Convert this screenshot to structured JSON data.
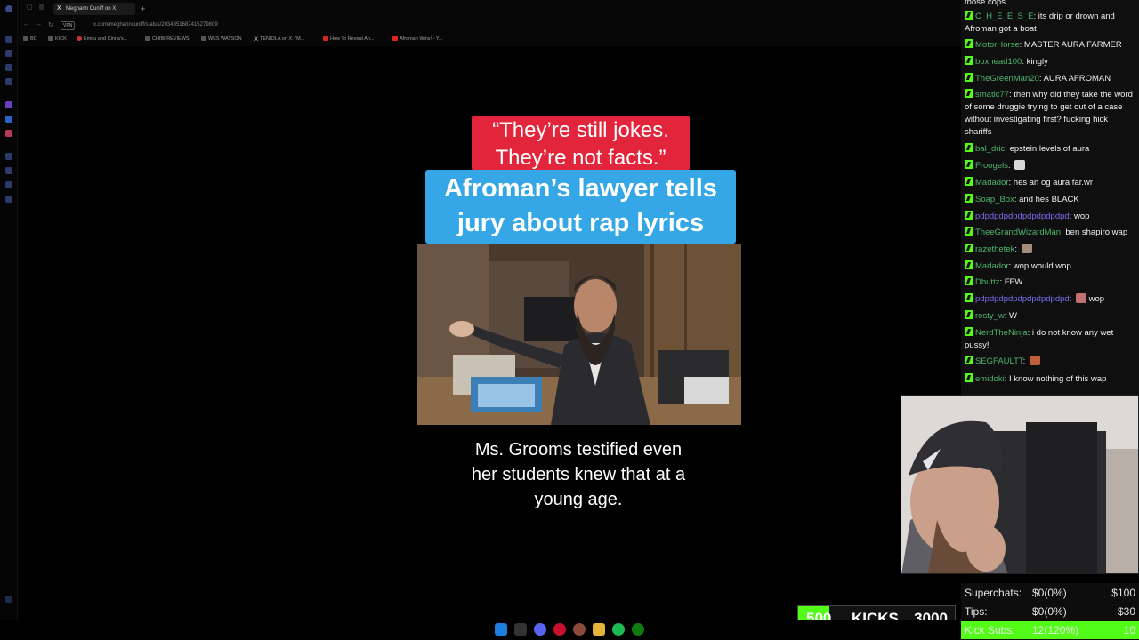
{
  "browser": {
    "tab_title": "Meghann Cuniff on X: ",
    "new_tab": "+",
    "vpn_label": "VPN",
    "url": "x.com/meghanncuniff/status/2034351687415279809",
    "bookmarks": [
      "BC",
      "KICK",
      "Emiru and Cinna's...",
      "CHIBI REVIEWS",
      "WES WATSON",
      "TENIOLA on X: \"M...",
      "How To Reveal An...",
      "Afroman Wins! - Y..."
    ]
  },
  "video": {
    "quote_line1": "“They’re still jokes.",
    "quote_line2": "They’re not facts.”",
    "headline_line1": "Afroman’s lawyer tells",
    "headline_line2": "jury about rap lyrics",
    "caption_line1": "Ms. Grooms testified even",
    "caption_line2": "her students knew that at a",
    "caption_line3": "young age."
  },
  "chat": {
    "messages": [
      {
        "user": "",
        "text": "those cops",
        "color": "#f0f0f0"
      },
      {
        "user": "C_H_E_E_S_E",
        "text": "its drip or drown and Afroman got a boat",
        "color": "#4fb46b"
      },
      {
        "user": "MotorHorse",
        "text": "MASTER AURA FARMER",
        "color": "#4fb46b"
      },
      {
        "user": "boxhead100",
        "text": "kingly",
        "color": "#4fb46b"
      },
      {
        "user": "TheGreenMan20",
        "text": "AURA AFROMAN",
        "color": "#4fb46b"
      },
      {
        "user": "smatic77",
        "text": "then why did they take the word of some druggie trying to get out of a case without investigating first? fucking hick shariffs",
        "color": "#4fb46b"
      },
      {
        "user": "bal_dric",
        "text": "epstein levels of aura",
        "color": "#4fb46b"
      },
      {
        "user": "Froogels",
        "text": "",
        "color": "#4fb46b",
        "emote": "#d8d8d8"
      },
      {
        "user": "Madador",
        "text": "hes an og aura far.wr",
        "color": "#4fb46b"
      },
      {
        "user": "Soap_Box",
        "text": "and hes BLACK",
        "color": "#4fb46b"
      },
      {
        "user": "pdpdpdpdpdpdpdpdpdpd",
        "text": "wop",
        "color": "#7b6cf0"
      },
      {
        "user": "TheeGrandWizardMan",
        "text": "ben shapiro wap",
        "color": "#4fb46b"
      },
      {
        "user": "razethetek",
        "text": "",
        "color": "#4fb46b",
        "emote": "#a58b7a"
      },
      {
        "user": "Madador",
        "text": "wop would wop",
        "color": "#4fb46b"
      },
      {
        "user": "Dbuttz",
        "text": "FFW",
        "color": "#4fb46b"
      },
      {
        "user": "pdpdpdpdpdpdpdpdpdpd",
        "text": "wop",
        "color": "#7b6cf0",
        "emote": "#c07070"
      },
      {
        "user": "rosty_w",
        "text": "W",
        "color": "#4fb46b"
      },
      {
        "user": "NerdTheNinja",
        "text": "i do not know any wet pussy!",
        "color": "#4fb46b"
      },
      {
        "user": "SEGFAULTT",
        "text": "",
        "color": "#4fb46b",
        "emote": "#c0603a"
      },
      {
        "user": "emidoki",
        "text": "I know nothing of this wap",
        "color": "#4fb46b"
      }
    ]
  },
  "stats": {
    "superchats_label": "Superchats:",
    "superchats_value": "$0(0%)",
    "superchats_goal": "$100",
    "tips_label": "Tips:",
    "tips_value": "$0(0%)",
    "tips_goal": "$30",
    "kicksubs_label": "Kick Subs:",
    "kicksubs_value": "12(120%)",
    "kicksubs_goal": "10",
    "kicksubs_progress": 1.0,
    "kick_min": "500",
    "kick_label": "KICKS",
    "kick_max": "3000",
    "kick_progress": 0.2,
    "accent_color": "#53fc18"
  }
}
